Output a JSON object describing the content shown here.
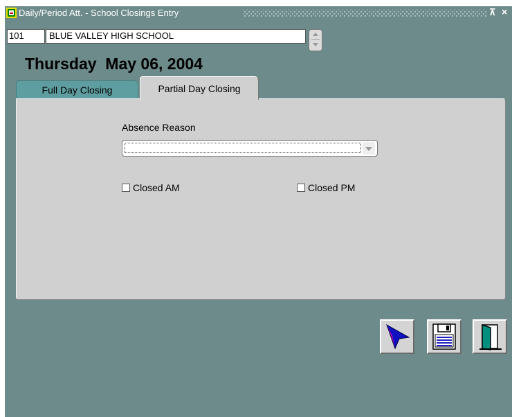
{
  "window": {
    "title": "Daily/Period Att. - School Closings Entry",
    "restore_glyph": "⊼",
    "close_glyph": "×"
  },
  "school": {
    "code": "101",
    "name": "BLUE VALLEY HIGH SCHOOL"
  },
  "date_label": "Thursday  May 06, 2004",
  "tabs": [
    {
      "label": "Full Day Closing",
      "active": false
    },
    {
      "label": "Partial Day Closing",
      "active": true
    }
  ],
  "form": {
    "absence_reason_label": "Absence Reason",
    "absence_reason_value": "",
    "closed_am_label": "Closed AM",
    "closed_am_checked": false,
    "closed_pm_label": "Closed PM",
    "closed_pm_checked": false
  },
  "toolbar": {
    "select_icon": "pointer-arrow-icon",
    "save_icon": "floppy-disk-icon",
    "exit_icon": "exit-door-icon"
  },
  "colors": {
    "background": "#6e8b8b",
    "panel": "#d0d0d0",
    "inactive_tab": "#5f9ea0",
    "pointer_blue": "#1010c0",
    "pointer_purple": "#c000c0",
    "door_green": "#009080"
  }
}
